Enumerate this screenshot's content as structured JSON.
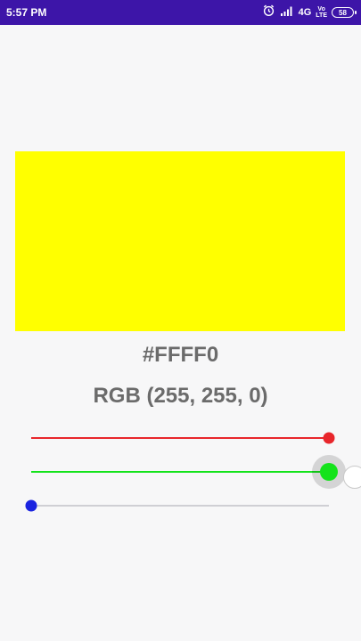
{
  "status_bar": {
    "time": "5:57 PM",
    "network": "4G",
    "volte_top": "Vo",
    "volte_bottom": "LTE",
    "battery": "58",
    "icons": [
      "alarm-icon",
      "signal-icon",
      "volte-icon",
      "battery-icon"
    ]
  },
  "preview": {
    "color": "#FFFF00"
  },
  "hex_text": "#FFFF0",
  "rgb_text": "RGB (255, 255, 0)",
  "sliders": [
    {
      "name": "red-slider",
      "value": 255,
      "max": 255,
      "color": "#e8262b"
    },
    {
      "name": "green-slider",
      "value": 255,
      "max": 255,
      "color": "#14e31b",
      "active": true
    },
    {
      "name": "blue-slider",
      "value": 0,
      "max": 255,
      "color": "#1b24e0"
    }
  ],
  "colors": {
    "status_bar": "#3d15a8",
    "label_text": "#6b6b6b",
    "track": "#cfcfd4"
  }
}
